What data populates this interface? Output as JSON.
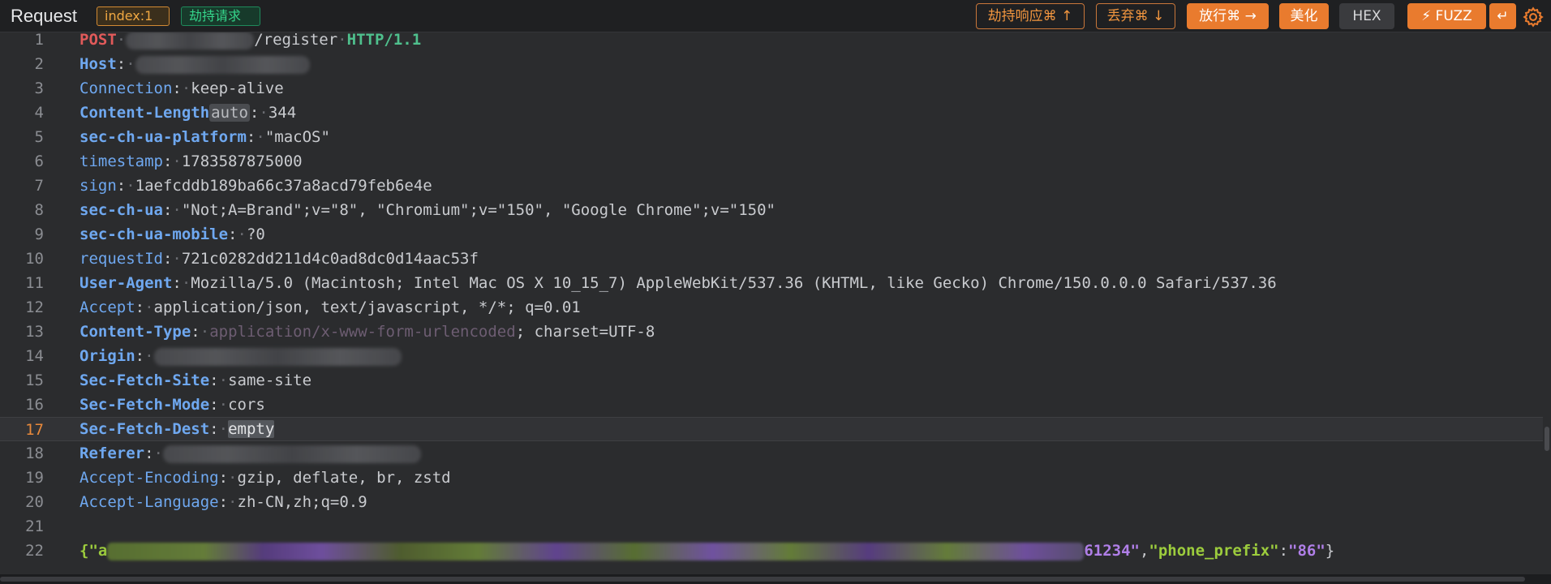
{
  "toolbar": {
    "title": "Request",
    "index_badge": "index:1",
    "intercept_badge": "劫持请求",
    "intercept_response_btn": "劫持响应⌘ ↑",
    "drop_btn": "丢弃⌘ ↓",
    "forward_btn": "放行⌘ →",
    "beautify_btn": "美化",
    "hex_btn": "HEX",
    "fuzz_btn": "⚡ FUZZ",
    "enter_icon": "↵",
    "settings_icon": "gear-icon"
  },
  "editor": {
    "active_line": 17,
    "lines": [
      {
        "n": "1",
        "method": "POST",
        "path": "/register",
        "protocol": "HTTP/1.1"
      },
      {
        "n": "2",
        "key": "Host",
        "value": ""
      },
      {
        "n": "3",
        "key": "Connection",
        "value": "keep-alive"
      },
      {
        "n": "4",
        "key": "Content-Length",
        "tag": "auto",
        "value": "344"
      },
      {
        "n": "5",
        "key": "sec-ch-ua-platform",
        "value": "\"macOS\""
      },
      {
        "n": "6",
        "key": "timestamp",
        "value": "1783587875000"
      },
      {
        "n": "7",
        "key": "sign",
        "value": "1aefcddb189ba66c37a8acd79feb6e4e"
      },
      {
        "n": "8",
        "key": "sec-ch-ua",
        "value": "\"Not;A=Brand\";v=\"8\", \"Chromium\";v=\"150\", \"Google Chrome\";v=\"150\""
      },
      {
        "n": "9",
        "key": "sec-ch-ua-mobile",
        "value": "?0"
      },
      {
        "n": "10",
        "key": "requestId",
        "value": "721c0282dd211d4c0ad8dc0d14aac53f"
      },
      {
        "n": "11",
        "key": "User-Agent",
        "value": "Mozilla/5.0 (Macintosh; Intel Mac OS X 10_15_7) AppleWebKit/537.36 (KHTML, like Gecko) Chrome/150.0.0.0 Safari/537.36"
      },
      {
        "n": "12",
        "key": "Accept",
        "value": "application/json, text/javascript, */*; q=0.01"
      },
      {
        "n": "13",
        "key": "Content-Type",
        "value_muted": "application/x-www-form-urlencoded",
        "value": "; charset=UTF-8"
      },
      {
        "n": "14",
        "key": "Origin",
        "value": ""
      },
      {
        "n": "15",
        "key": "Sec-Fetch-Site",
        "value": "same-site"
      },
      {
        "n": "16",
        "key": "Sec-Fetch-Mode",
        "value": "cors"
      },
      {
        "n": "17",
        "key": "Sec-Fetch-Dest",
        "value": "empty"
      },
      {
        "n": "18",
        "key": "Referer",
        "value": ""
      },
      {
        "n": "19",
        "key": "Accept-Encoding",
        "value": "gzip, deflate, br, zstd"
      },
      {
        "n": "20",
        "key": "Accept-Language",
        "value": "zh-CN,zh;q=0.9"
      },
      {
        "n": "21"
      },
      {
        "n": "22",
        "body_open": "{\"a",
        "body_tail": "61234\"",
        "body_key": "\"phone_prefix\"",
        "body_val": "\"86\"",
        "body_close": "}"
      }
    ]
  },
  "colors": {
    "accent": "#e97b2e",
    "header_key": "#6fa8f0",
    "method": "#e15a5a",
    "protocol": "#4fc08d",
    "json_string": "#9ccc3d",
    "json_number": "#b07fe8",
    "active_line_number": "#e8893b"
  }
}
